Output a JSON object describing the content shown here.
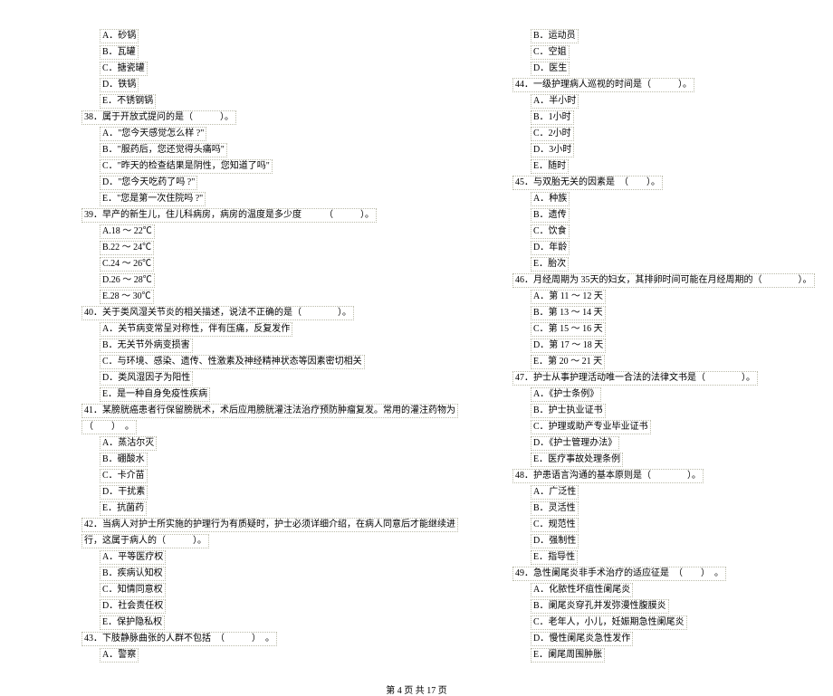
{
  "footer": {
    "text": "第 4 页 共 17 页"
  },
  "left": [
    {
      "cls": "indent1",
      "dotted": true,
      "t": "A．砂锅"
    },
    {
      "cls": "indent1",
      "dotted": true,
      "t": "B．瓦罐"
    },
    {
      "cls": "indent1",
      "dotted": true,
      "t": "C．搪瓷罐"
    },
    {
      "cls": "indent1",
      "dotted": true,
      "t": "D．铁锅"
    },
    {
      "cls": "indent1",
      "dotted": true,
      "t": "E．不锈钢锅"
    },
    {
      "cls": "indent0",
      "dotted": true,
      "t": "38．属于开放式提问的是（　　　）。"
    },
    {
      "cls": "indent1",
      "dotted": true,
      "t": "A．\"您今天感觉怎么样  ?\""
    },
    {
      "cls": "indent1",
      "dotted": true,
      "t": "B．\"服药后，您还觉得头痛吗\""
    },
    {
      "cls": "indent1",
      "dotted": true,
      "t": "C．\"昨天的检查结果是阴性，您知道了吗\""
    },
    {
      "cls": "indent1",
      "dotted": true,
      "t": "D．\"您今天吃药了吗  ?\""
    },
    {
      "cls": "indent1",
      "dotted": true,
      "t": "E．\"您是第一次住院吗  ?\""
    },
    {
      "cls": "indent0",
      "dotted": true,
      "t": "39．早产的新生儿，住儿科病房，病房的温度是多少度　　　（　　　）。"
    },
    {
      "cls": "indent1",
      "dotted": true,
      "t": "A.18 ～ 22℃"
    },
    {
      "cls": "indent1",
      "dotted": true,
      "t": "B.22 ～ 24℃"
    },
    {
      "cls": "indent1",
      "dotted": true,
      "t": "C.24 ～ 26℃"
    },
    {
      "cls": "indent1",
      "dotted": true,
      "t": "D.26 ～ 28℃"
    },
    {
      "cls": "indent1",
      "dotted": true,
      "t": "E.28 ～ 30℃"
    },
    {
      "cls": "indent0",
      "dotted": true,
      "t": "40．关于类风湿关节炎的相关描述，说法不正确的是（　　　　）。"
    },
    {
      "cls": "indent1",
      "dotted": true,
      "t": "A．关节病变常呈对称性，伴有压痛，反复发作"
    },
    {
      "cls": "indent1",
      "dotted": true,
      "t": "B．无关节外病变损害"
    },
    {
      "cls": "indent1",
      "dotted": true,
      "t": "C．与环境、感染、遗传、性激素及神经精神状态等因素密切相关"
    },
    {
      "cls": "indent1",
      "dotted": true,
      "t": "D．类风湿因子为阳性"
    },
    {
      "cls": "indent1",
      "dotted": true,
      "t": "E．是一种自身免疫性疾病"
    },
    {
      "cls": "indent0",
      "dotted": true,
      "t": "41．某膀胱癌患者行保留膀胱术，术后应用膀胱灌注法治疗预防肿瘤复发。常用的灌注药物为"
    },
    {
      "cls": "indent0",
      "dotted": true,
      "t": "（　　）　。"
    },
    {
      "cls": "indent1",
      "dotted": true,
      "t": "A．蒸沽尔灭"
    },
    {
      "cls": "indent1",
      "dotted": true,
      "t": "B．硼酸水"
    },
    {
      "cls": "indent1",
      "dotted": true,
      "t": "C．卡介苗"
    },
    {
      "cls": "indent1",
      "dotted": true,
      "t": "D．干扰素"
    },
    {
      "cls": "indent1",
      "dotted": true,
      "t": "E．抗菌药"
    },
    {
      "cls": "indent0",
      "dotted": true,
      "t": "42．当病人对护士所实施的护理行为有质疑时，护士必须详细介绍，在病人同意后才能继续进"
    },
    {
      "cls": "indent0",
      "dotted": true,
      "t": "行，这属于病人的（　　　）。"
    },
    {
      "cls": "indent1",
      "dotted": true,
      "t": "A．平等医疗权"
    },
    {
      "cls": "indent1",
      "dotted": true,
      "t": "B．疾病认知权"
    },
    {
      "cls": "indent1",
      "dotted": true,
      "t": "C．知情同意权"
    },
    {
      "cls": "indent1",
      "dotted": true,
      "t": "D．社会责任权"
    },
    {
      "cls": "indent1",
      "dotted": true,
      "t": "E．保护隐私权"
    },
    {
      "cls": "indent0",
      "dotted": true,
      "t": "43．下肢静脉曲张的人群不包括　（　　　）　。"
    },
    {
      "cls": "indent1",
      "dotted": true,
      "t": "A．警察"
    }
  ],
  "right": [
    {
      "cls": "indent1",
      "dotted": true,
      "t": "B．运动员"
    },
    {
      "cls": "indent1",
      "dotted": true,
      "t": "C．空姐"
    },
    {
      "cls": "indent1",
      "dotted": true,
      "t": "D．医生"
    },
    {
      "cls": "indent0",
      "dotted": true,
      "t": "44．一级护理病人巡视的时间是（　　　）。"
    },
    {
      "cls": "indent1",
      "dotted": true,
      "t": "A．半小时"
    },
    {
      "cls": "indent1",
      "dotted": true,
      "t": "B．1小时"
    },
    {
      "cls": "indent1",
      "dotted": true,
      "t": "C．2小时"
    },
    {
      "cls": "indent1",
      "dotted": true,
      "t": "D．3小时"
    },
    {
      "cls": "indent1",
      "dotted": true,
      "t": "E．随时"
    },
    {
      "cls": "indent0",
      "dotted": true,
      "t": "45．与双胎无关的因素是　（　　）。"
    },
    {
      "cls": "indent1",
      "dotted": true,
      "t": "A．种族"
    },
    {
      "cls": "indent1",
      "dotted": true,
      "t": "B．遗传"
    },
    {
      "cls": "indent1",
      "dotted": true,
      "t": "C．饮食"
    },
    {
      "cls": "indent1",
      "dotted": true,
      "t": "D．年龄"
    },
    {
      "cls": "indent1",
      "dotted": true,
      "t": "E．胎次"
    },
    {
      "cls": "indent0",
      "dotted": true,
      "t": "46．月经周期为  35天的妇女，其排卵时间可能在月经周期的（　　　　）。"
    },
    {
      "cls": "indent1",
      "dotted": true,
      "t": "A．第 11 ～ 12 天"
    },
    {
      "cls": "indent1",
      "dotted": true,
      "t": "B．第 13 ～ 14 天"
    },
    {
      "cls": "indent1",
      "dotted": true,
      "t": "C．第 15 ～ 16 天"
    },
    {
      "cls": "indent1",
      "dotted": true,
      "t": "D．第 17 ～ 18 天"
    },
    {
      "cls": "indent1",
      "dotted": true,
      "t": "E．第 20 ～ 21 天"
    },
    {
      "cls": "indent0",
      "dotted": true,
      "t": "47．护士从事护理活动唯一合法的法律文书是（　　　　）。"
    },
    {
      "cls": "indent1",
      "dotted": true,
      "t": "A．《护士条例》"
    },
    {
      "cls": "indent1",
      "dotted": true,
      "t": "B．护士执业证书"
    },
    {
      "cls": "indent1",
      "dotted": true,
      "t": "C．护理或助产专业毕业证书"
    },
    {
      "cls": "indent1",
      "dotted": true,
      "t": "D．《护士管理办法》"
    },
    {
      "cls": "indent1",
      "dotted": true,
      "t": "E．医疗事故处理条例"
    },
    {
      "cls": "indent0",
      "dotted": true,
      "t": "48．护患语言沟通的基本原则是（　　　　）。"
    },
    {
      "cls": "indent1",
      "dotted": true,
      "t": "A．广泛性"
    },
    {
      "cls": "indent1",
      "dotted": true,
      "t": "B．灵活性"
    },
    {
      "cls": "indent1",
      "dotted": true,
      "t": "C．规范性"
    },
    {
      "cls": "indent1",
      "dotted": true,
      "t": "D．强制性"
    },
    {
      "cls": "indent1",
      "dotted": true,
      "t": "E．指导性"
    },
    {
      "cls": "indent0",
      "dotted": true,
      "t": "49．急性阑尾炎非手术治疗的适应征是　（　　）　。"
    },
    {
      "cls": "indent1",
      "dotted": true,
      "t": "A．化脓性坏疽性阑尾炎"
    },
    {
      "cls": "indent1",
      "dotted": true,
      "t": "B．阑尾炎穿孔并发弥漫性腹膜炎"
    },
    {
      "cls": "indent1",
      "dotted": true,
      "t": "C．老年人，小儿，妊娠期急性阑尾炎"
    },
    {
      "cls": "indent1",
      "dotted": true,
      "t": "D．慢性阑尾炎急性发作"
    },
    {
      "cls": "indent1",
      "dotted": true,
      "t": "E．阑尾周围肿胀"
    }
  ]
}
